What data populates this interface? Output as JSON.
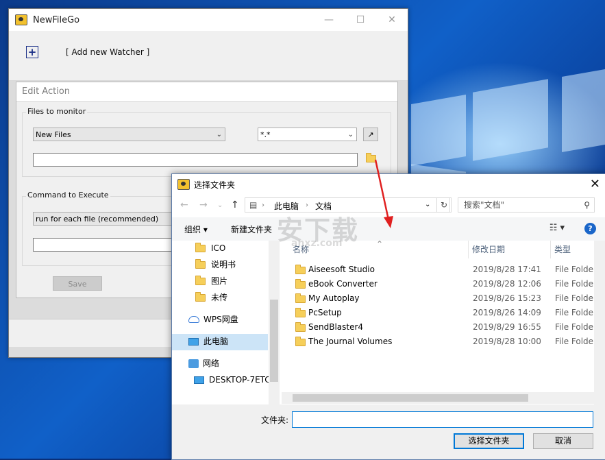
{
  "app": {
    "title": "NewFileGo",
    "add_watcher_label": "[ Add new Watcher ]",
    "edit_action_title": "Edit Action",
    "files_group_label": "Files to monitor",
    "files_event_value": "New Files",
    "filter_value": "*.*",
    "command_group_label": "Command to Execute",
    "command_mode_value": "run for each file  (recommended)",
    "save_label": "Save"
  },
  "dialog": {
    "title": "选择文件夹",
    "breadcrumb": [
      "此电脑",
      "文档"
    ],
    "search_placeholder": "搜索\"文档\"",
    "organize_label": "组织 ▾",
    "new_folder_label": "新建文件夹",
    "columns": {
      "name": "名称",
      "date": "修改日期",
      "type": "类型"
    },
    "nav_items": [
      {
        "label": "ICO",
        "kind": "folder"
      },
      {
        "label": "说明书",
        "kind": "folder"
      },
      {
        "label": "图片",
        "kind": "folder"
      },
      {
        "label": "未传",
        "kind": "folder"
      },
      {
        "label": "WPS网盘",
        "kind": "cloud"
      },
      {
        "label": "此电脑",
        "kind": "pc",
        "selected": true
      },
      {
        "label": "网络",
        "kind": "network"
      },
      {
        "label": "DESKTOP-7ETC",
        "kind": "pc"
      }
    ],
    "files": [
      {
        "name": "Aiseesoft Studio",
        "date": "2019/8/28 17:41",
        "type": "File Folder"
      },
      {
        "name": "eBook Converter",
        "date": "2019/8/28 12:06",
        "type": "File Folder"
      },
      {
        "name": "My Autoplay",
        "date": "2019/8/26 15:23",
        "type": "File Folder"
      },
      {
        "name": "PcSetup",
        "date": "2019/8/26 14:09",
        "type": "File Folder"
      },
      {
        "name": "SendBlaster4",
        "date": "2019/8/29 16:55",
        "type": "File Folder"
      },
      {
        "name": "The Journal Volumes",
        "date": "2019/8/28 10:00",
        "type": "File Folder"
      }
    ],
    "folder_field_label": "文件夹:",
    "folder_field_value": "",
    "select_button_label": "选择文件夹",
    "cancel_button_label": "取消"
  },
  "watermark": {
    "text": "安下载",
    "sub": "anxz.com"
  },
  "colors": {
    "accent": "#0078d7",
    "arrow": "#e02020",
    "folder": "#f6cf5a"
  }
}
